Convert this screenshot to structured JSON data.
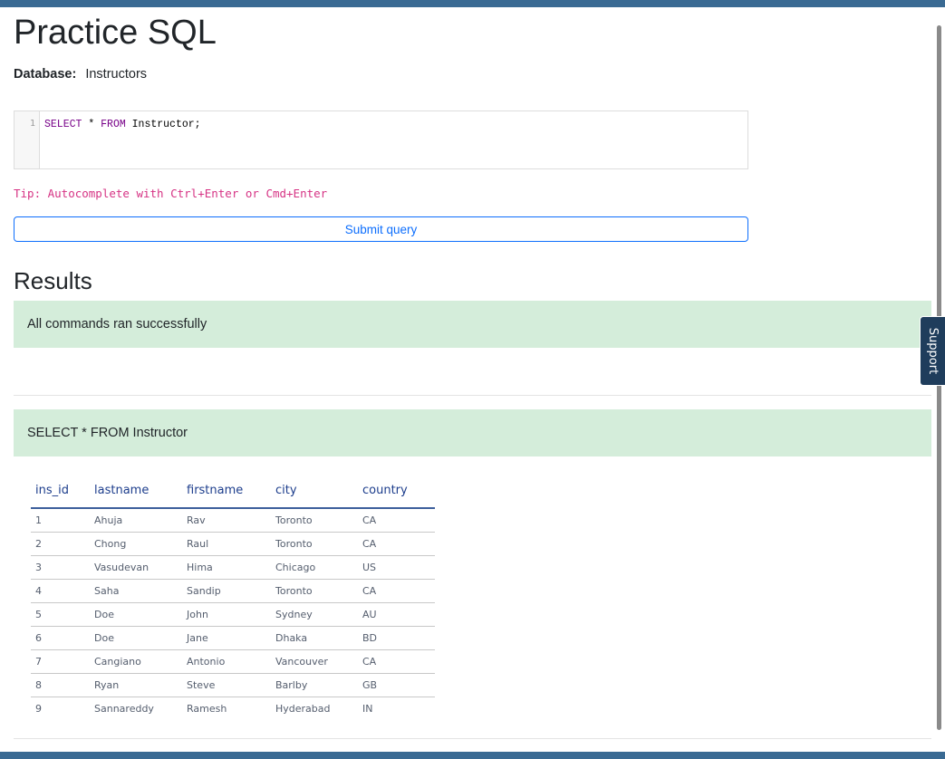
{
  "page": {
    "title": "Practice SQL",
    "database_label": "Database:",
    "database_name": "Instructors"
  },
  "editor": {
    "line_number": "1",
    "code_keyword_1": "SELECT",
    "code_middle": " * ",
    "code_keyword_2": "FROM",
    "code_rest": " Instructor;"
  },
  "tip": "Tip: Autocomplete with Ctrl+Enter or Cmd+Enter",
  "submit_label": "Submit query",
  "results": {
    "title": "Results",
    "success_message": "All commands ran successfully",
    "query_label": "SELECT * FROM Instructor",
    "columns": [
      "ins_id",
      "lastname",
      "firstname",
      "city",
      "country"
    ],
    "rows": [
      [
        "1",
        "Ahuja",
        "Rav",
        "Toronto",
        "CA"
      ],
      [
        "2",
        "Chong",
        "Raul",
        "Toronto",
        "CA"
      ],
      [
        "3",
        "Vasudevan",
        "Hima",
        "Chicago",
        "US"
      ],
      [
        "4",
        "Saha",
        "Sandip",
        "Toronto",
        "CA"
      ],
      [
        "5",
        "Doe",
        "John",
        "Sydney",
        "AU"
      ],
      [
        "6",
        "Doe",
        "Jane",
        "Dhaka",
        "BD"
      ],
      [
        "7",
        "Cangiano",
        "Antonio",
        "Vancouver",
        "CA"
      ],
      [
        "8",
        "Ryan",
        "Steve",
        "Barlby",
        "GB"
      ],
      [
        "9",
        "Sannareddy",
        "Ramesh",
        "Hyderabad",
        "IN"
      ]
    ]
  },
  "support_label": "Support",
  "colors": {
    "accent_bar": "#3a6a93",
    "success_bg": "#d4edda",
    "tip": "#d63384",
    "button": "#0d6efd"
  }
}
